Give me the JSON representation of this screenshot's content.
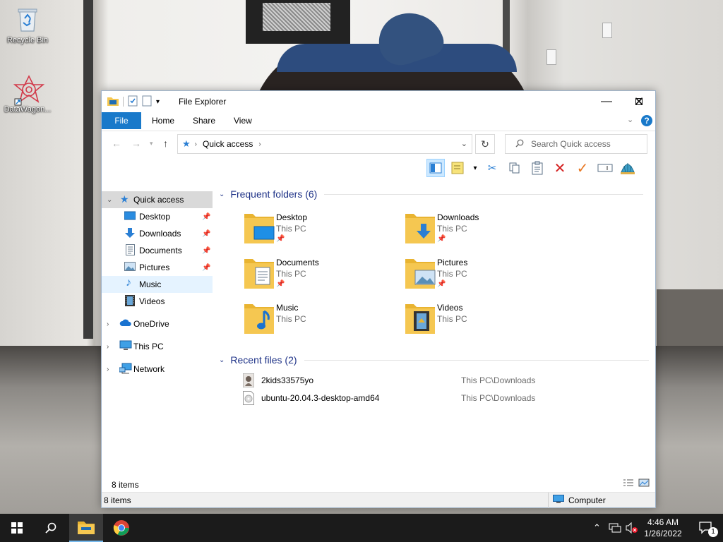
{
  "desktop": {
    "icons": [
      {
        "label": "Recycle Bin",
        "icon": "recycle-bin-icon"
      },
      {
        "label": "DataWagon...",
        "icon": "datawagon-icon"
      }
    ]
  },
  "window": {
    "title": "File Explorer",
    "menu": {
      "file": "File",
      "home": "Home",
      "share": "Share",
      "view": "View"
    },
    "help": "?",
    "address": {
      "crumb": "Quick access"
    },
    "search": {
      "placeholder": "Search Quick access"
    }
  },
  "nav": {
    "quick_access": "Quick access",
    "items": [
      {
        "label": "Desktop",
        "icon": "desktop-icon",
        "pinned": true
      },
      {
        "label": "Downloads",
        "icon": "download-arrow-icon",
        "pinned": true
      },
      {
        "label": "Documents",
        "icon": "document-icon",
        "pinned": true
      },
      {
        "label": "Pictures",
        "icon": "picture-icon",
        "pinned": true
      },
      {
        "label": "Music",
        "icon": "music-note-icon",
        "pinned": false
      },
      {
        "label": "Videos",
        "icon": "film-icon",
        "pinned": false
      }
    ],
    "onedrive": "OneDrive",
    "this_pc": "This PC",
    "network": "Network"
  },
  "frequent": {
    "heading": "Frequent folders (6)",
    "folders": [
      {
        "name": "Desktop",
        "location": "This PC",
        "pinned": true
      },
      {
        "name": "Downloads",
        "location": "This PC",
        "pinned": true
      },
      {
        "name": "Documents",
        "location": "This PC",
        "pinned": true
      },
      {
        "name": "Pictures",
        "location": "This PC",
        "pinned": true
      },
      {
        "name": "Music",
        "location": "This PC",
        "pinned": false
      },
      {
        "name": "Videos",
        "location": "This PC",
        "pinned": false
      }
    ]
  },
  "recent": {
    "heading": "Recent files (2)",
    "files": [
      {
        "name": "2kids33575yo",
        "path": "This PC\\Downloads",
        "icon": "image-thumbnail-icon"
      },
      {
        "name": "ubuntu-20.04.3-desktop-amd64",
        "path": "This PC\\Downloads",
        "icon": "disc-image-icon"
      }
    ]
  },
  "status": {
    "items_top": "8 items",
    "items_bottom": "8 items",
    "computer": "Computer"
  },
  "taskbar": {
    "time": "4:46 AM",
    "date": "1/26/2022",
    "notifications": "1"
  },
  "colors": {
    "accent": "#1979ca",
    "heading": "#1e3287",
    "folder": "#f5c751",
    "taskbar": "#1b1b1b"
  }
}
